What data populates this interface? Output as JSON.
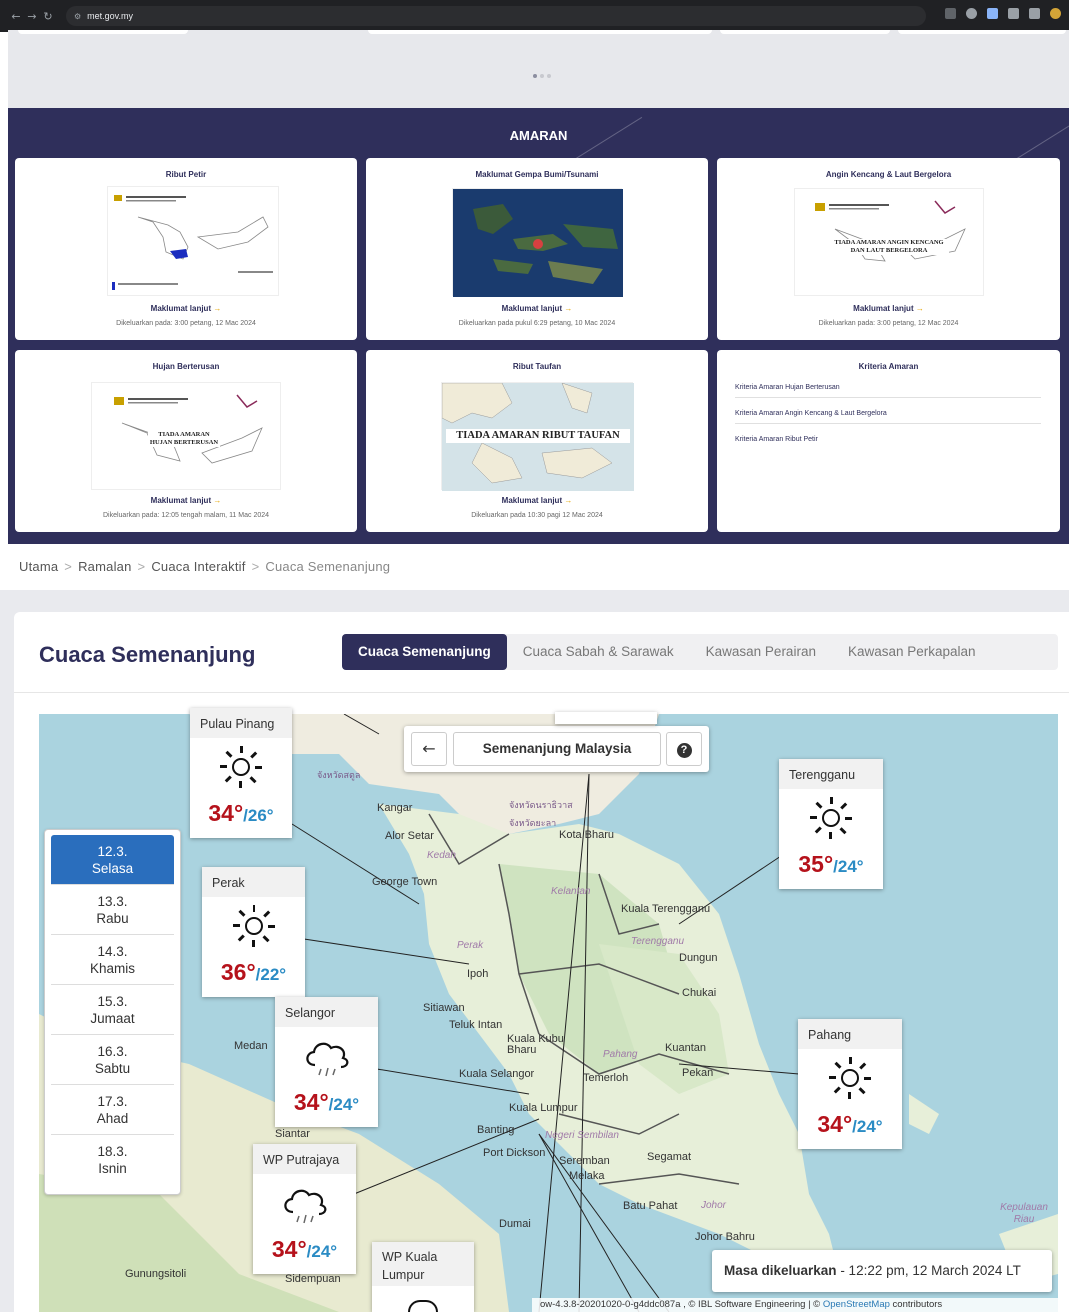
{
  "browser": {
    "url": "met.gov.my"
  },
  "amaran": {
    "title": "AMARAN",
    "cards": [
      {
        "title": "Ribut Petir",
        "more": "Maklumat lanjut",
        "issued": "Dikeluarkan pada: 3:00 petang, 12 Mac 2024"
      },
      {
        "title": "Maklumat Gempa Bumi/Tsunami",
        "more": "Maklumat lanjut",
        "issued": "Dikeluarkan pada pukul 6:29 petang, 10 Mac 2024"
      },
      {
        "title": "Angin Kencang & Laut Bergelora",
        "more": "Maklumat lanjut",
        "issued": "Dikeluarkan pada: 3:00 petang, 12 Mac 2024",
        "thumb_text": "TIADA AMARAN ANGIN KENCANG DAN LAUT BERGELORA"
      },
      {
        "title": "Hujan Berterusan",
        "more": "Maklumat lanjut",
        "issued": "Dikeluarkan pada: 12:05 tengah malam, 11 Mac 2024",
        "thumb_text": "TIADA AMARAN HUJAN BERTERUSAN"
      },
      {
        "title": "Ribut Taufan",
        "more": "Maklumat lanjut",
        "issued": "Dikeluarkan pada 10:30 pagi 12 Mac 2024",
        "thumb_text": "TIADA AMARAN RIBUT TAUFAN"
      }
    ],
    "kriteria": {
      "title": "Kriteria Amaran",
      "links": [
        "Kriteria Amaran Hujan Berterusan",
        "Kriteria Amaran Angin Kencang & Laut Bergelora",
        "Kriteria Amaran Ribut Petir"
      ]
    }
  },
  "breadcrumb": [
    "Utama",
    "Ramalan",
    "Cuaca Interaktif",
    "Cuaca Semenanjung"
  ],
  "cuaca": {
    "title": "Cuaca Semenanjung",
    "tabs": [
      "Cuaca Semenanjung",
      "Cuaca Sabah & Sarawak",
      "Kawasan Perairan",
      "Kawasan Perkapalan"
    ],
    "region": "Semenanjung Malaysia",
    "days": [
      {
        "date": "12.3.",
        "day": "Selasa"
      },
      {
        "date": "13.3.",
        "day": "Rabu"
      },
      {
        "date": "14.3.",
        "day": "Khamis"
      },
      {
        "date": "15.3.",
        "day": "Jumaat"
      },
      {
        "date": "16.3.",
        "day": "Sabtu"
      },
      {
        "date": "17.3.",
        "day": "Ahad"
      },
      {
        "date": "18.3.",
        "day": "Isnin"
      }
    ],
    "stations": [
      {
        "name": "Pulau Pinang",
        "icon": "sun-icon",
        "hi": "34°",
        "lo": "/26°"
      },
      {
        "name": "Perak",
        "icon": "sun-icon",
        "hi": "36°",
        "lo": "/22°"
      },
      {
        "name": "Selangor",
        "icon": "rain-cloud-icon",
        "hi": "34°",
        "lo": "/24°"
      },
      {
        "name": "WP Putrajaya",
        "icon": "rain-cloud-icon",
        "hi": "34°",
        "lo": "/24°"
      },
      {
        "name": "WP Kuala Lumpur",
        "icon": "rain-cloud-icon",
        "hi": "",
        "lo": ""
      },
      {
        "name": "Terengganu",
        "icon": "sun-icon",
        "hi": "35°",
        "lo": "/24°"
      },
      {
        "name": "Pahang",
        "icon": "sun-icon",
        "hi": "34°",
        "lo": "/24°"
      }
    ],
    "issued_label": "Masa dikeluarkan",
    "issued_value": " - 12:22 pm, 12 March 2024 LT",
    "attribution": "ow-4.3.8-20201020-0-g4ddc087a , © IBL Software Engineering | © ",
    "attribution_link": "OpenStreetMap",
    "attribution_tail": " contributors",
    "map_labels": [
      "Kangar",
      "Alor Setar",
      "Kedah",
      "George Town",
      "Kota Bharu",
      "Kelantan",
      "Kuala Terengganu",
      "Terengganu",
      "Dungun",
      "Chukai",
      "Perak",
      "Ipoh",
      "Sitiawan",
      "Teluk Intan",
      "Kuala Kubu Bharu",
      "Pahang",
      "Kuantan",
      "Pekan",
      "Temerloh",
      "Kuala Selangor",
      "Kuala Lumpur",
      "Banting",
      "Port Dickson",
      "Negeri Sembilan",
      "Seremban",
      "Melaka",
      "Segamat",
      "Batu Pahat",
      "Johor",
      "Johor Bahru",
      "Medan",
      "Siantar",
      "Gunungsitoli",
      "Sidempuan",
      "Dumai",
      "Kepulauan Riau",
      "จังหวัดสตูล",
      "จังหวัดนราธิวาส",
      "จังหวัดยะลา"
    ]
  }
}
